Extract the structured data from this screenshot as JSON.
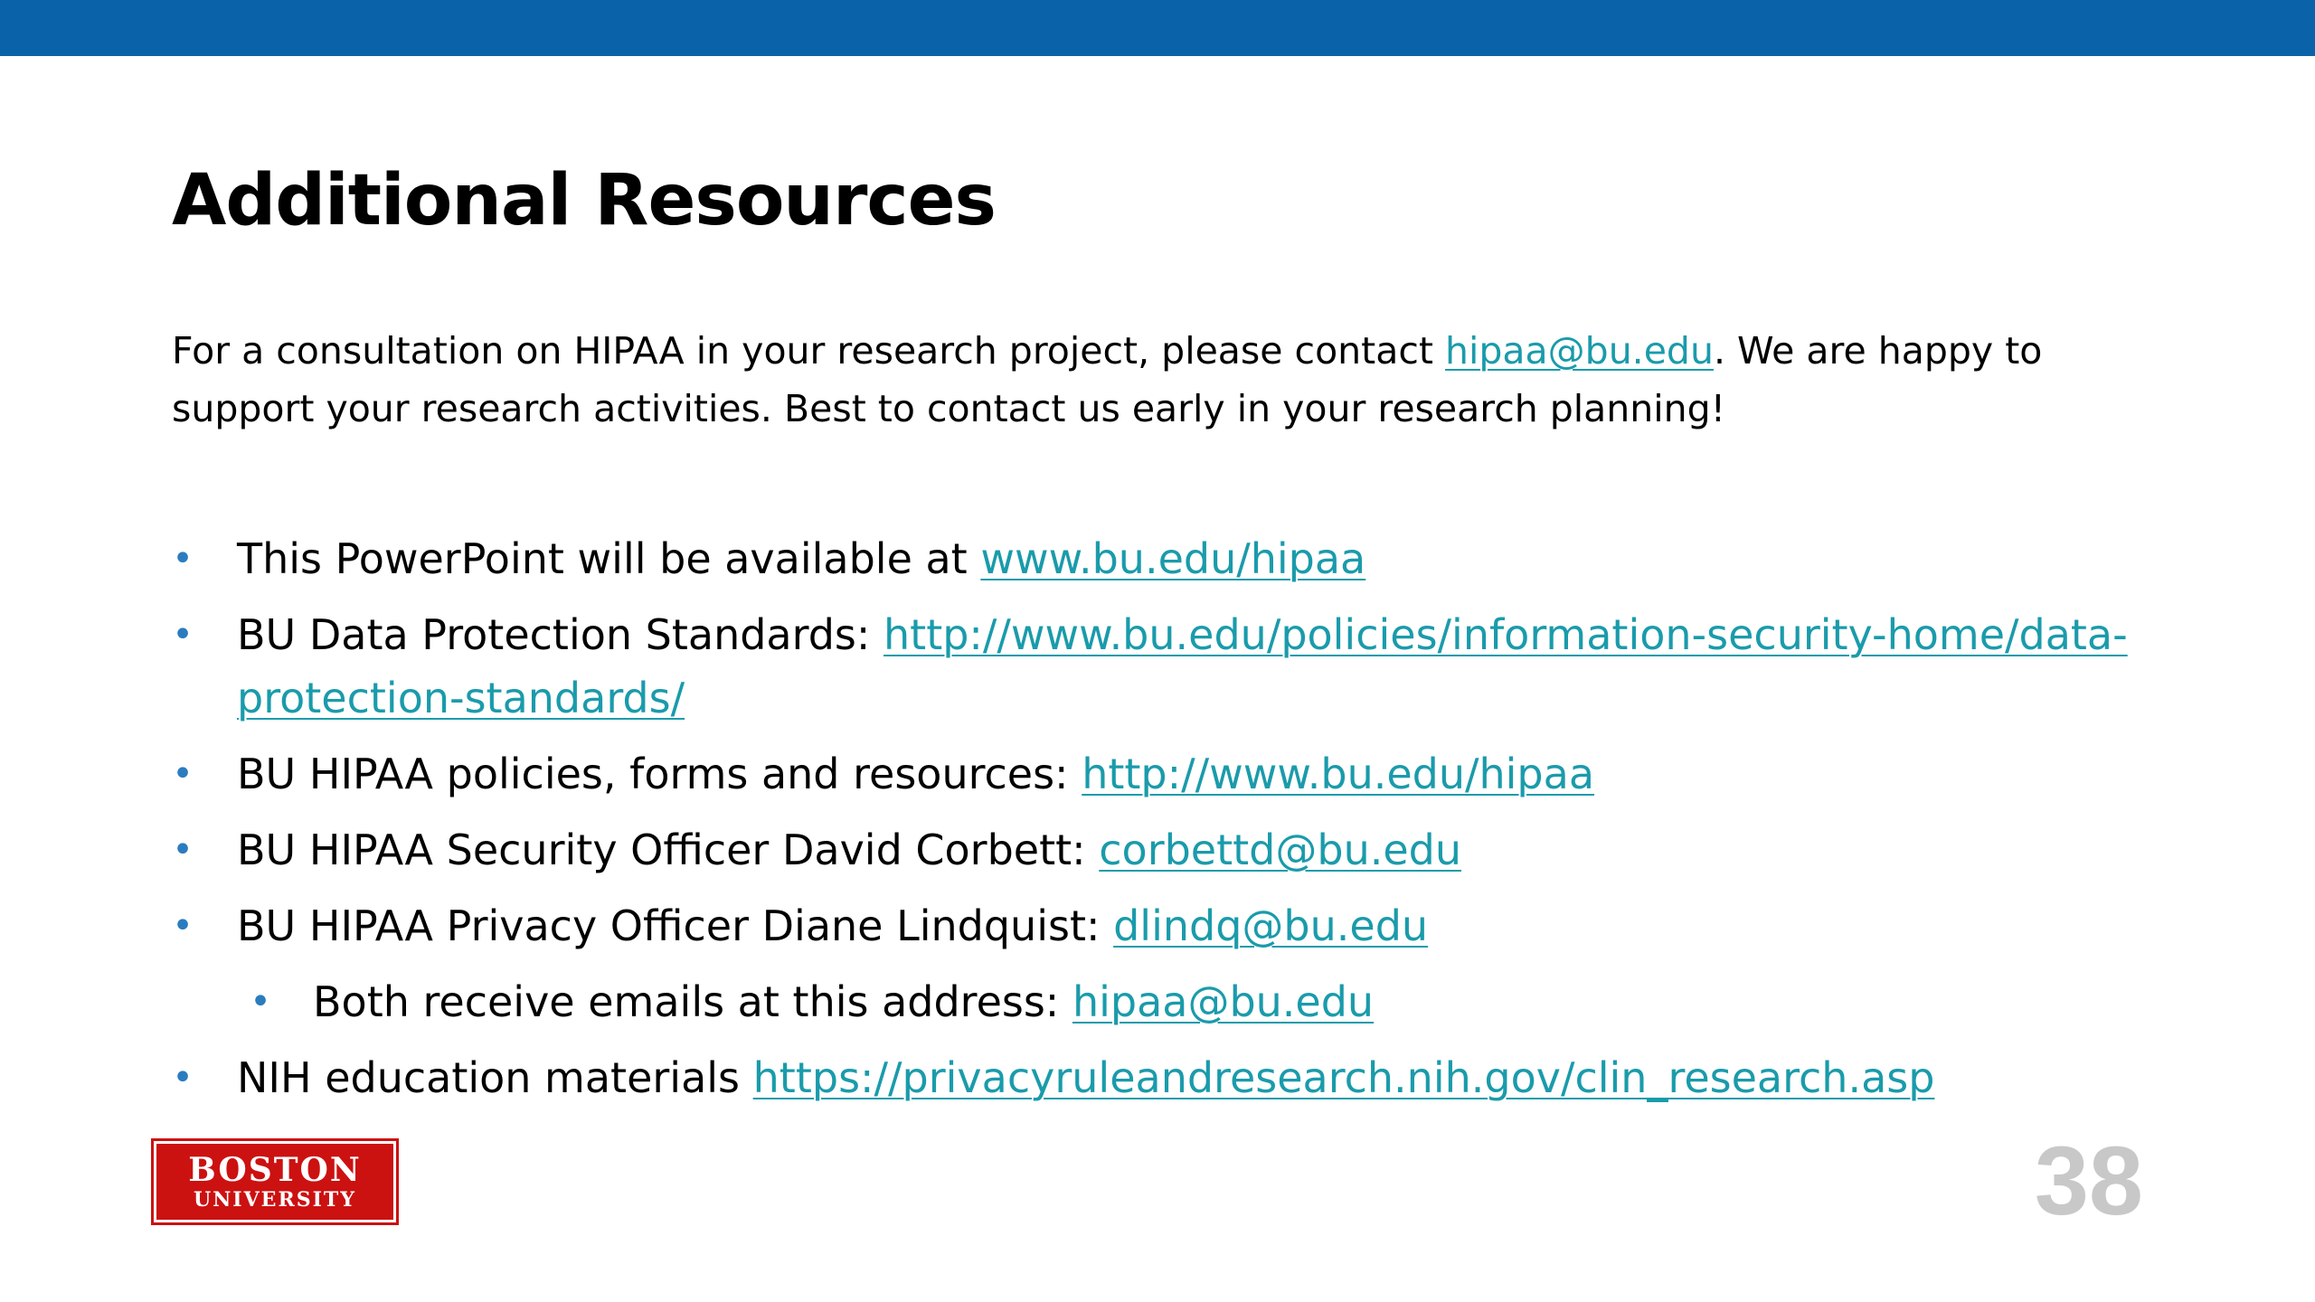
{
  "slide": {
    "title": "Additional Resources",
    "intro": {
      "text_before": "For a consultation on HIPAA in your research project, please contact ",
      "link": "hipaa@bu.edu",
      "text_after": ".  We are happy to support your research activities.  Best to contact us early in your research planning!"
    },
    "bullets": [
      {
        "text": "This PowerPoint will be available at ",
        "link": "www.bu.edu/hipaa"
      },
      {
        "text": "BU Data Protection Standards: ",
        "link": "http://www.bu.edu/policies/information-security-home/data-protection-standards/"
      },
      {
        "text": "BU HIPAA policies, forms and resources: ",
        "link": "http://www.bu.edu/hipaa"
      },
      {
        "text": "BU HIPAA Security Officer David Corbett: ",
        "link": "corbettd@bu.edu"
      },
      {
        "text": "BU HIPAA Privacy Officer Diane Lindquist: ",
        "link": "dlindq@bu.edu"
      },
      {
        "text": "Both receive emails at this address: ",
        "link": "hipaa@bu.edu"
      },
      {
        "text": "NIH education materials ",
        "link": "https://privacyruleandresearch.nih.gov/clin_research.asp"
      }
    ],
    "logo": {
      "line1": "BOSTON",
      "line2": "UNIVERSITY"
    },
    "page_number": "38",
    "bullet_symbol": "•"
  },
  "colors": {
    "top_bar": "#0a63a8",
    "link": "#1a9bab",
    "bullet": "#2b7cbf",
    "logo_bg": "#cc1111",
    "page_number": "#c8c8c8"
  }
}
